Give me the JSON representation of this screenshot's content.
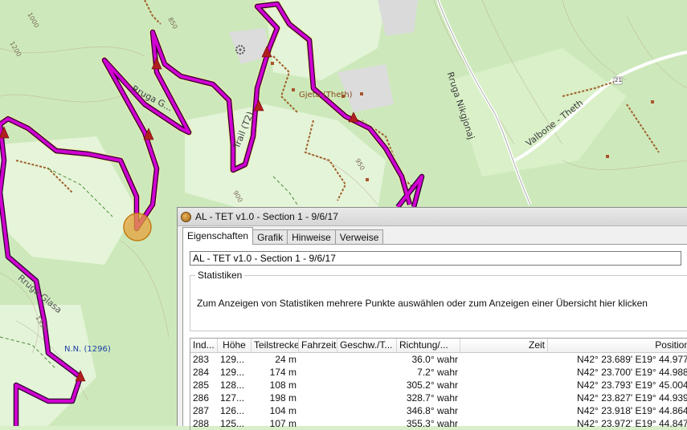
{
  "map": {
    "labels": {
      "rruga_nikgjonaj": "Rruga Nikgjonaj",
      "valbone_theth": "Valbone - Theth",
      "gjeta_theth": "Gjeta (Theth)",
      "trail_t2": "Trail (T2)",
      "rruga_g": "Rruga G...",
      "rruga_glasa": "Rruga Glasa",
      "nn_1296": "N.N. (1296)",
      "contour_1000": "1000",
      "contour_1350": "1350",
      "contour_1200": "1200",
      "contour_850": "850",
      "contour_900": "900",
      "contour_950": "950",
      "road_number": "21"
    },
    "colors": {
      "forest": "#cde9bb",
      "meadow": "#e3f3d6",
      "track": "#cc00cc",
      "highlight": "#e6a23c"
    }
  },
  "dialog": {
    "title": "AL - TET v1.0 - Section 1 - 9/6/17",
    "tabs": [
      "Eigenschaften",
      "Grafik",
      "Hinweise",
      "Verweise"
    ],
    "active_tab": "Eigenschaften",
    "name_value": "AL - TET v1.0 - Section 1 - 9/6/17",
    "stats": {
      "legend": "Statistiken",
      "text": "Zum Anzeigen von Statistiken mehrere Punkte auswählen oder zum Anzeigen einer Übersicht hier klicken"
    },
    "table": {
      "columns": [
        "Ind...",
        "Höhe",
        "Teilstrecke",
        "Fahrzeit",
        "Geschw./T...",
        "Richtung/...",
        "Zeit",
        "Position"
      ],
      "rows": [
        [
          "283",
          "129...",
          "24 m",
          "",
          "",
          "36.0° wahr",
          "",
          "N42° 23.689' E19° 44.977'"
        ],
        [
          "284",
          "129...",
          "174 m",
          "",
          "",
          "7.2° wahr",
          "",
          "N42° 23.700' E19° 44.988'"
        ],
        [
          "285",
          "128...",
          "108 m",
          "",
          "",
          "305.2° wahr",
          "",
          "N42° 23.793' E19° 45.004'"
        ],
        [
          "286",
          "127...",
          "198 m",
          "",
          "",
          "328.7° wahr",
          "",
          "N42° 23.827' E19° 44.939'"
        ],
        [
          "287",
          "126...",
          "104 m",
          "",
          "",
          "346.8° wahr",
          "",
          "N42° 23.918' E19° 44.864'"
        ],
        [
          "288",
          "125...",
          "107 m",
          "",
          "",
          "355.3° wahr",
          "",
          "N42° 23.972' E19° 44.847'"
        ]
      ]
    }
  }
}
